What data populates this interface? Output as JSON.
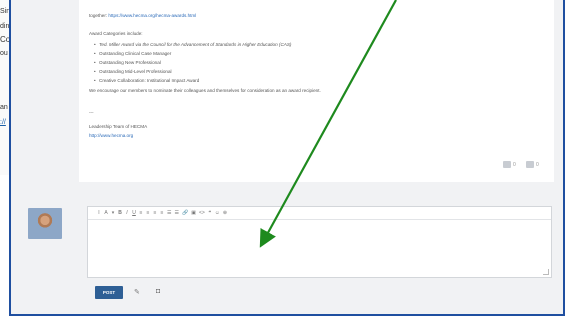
{
  "background_page": {
    "fragments": [
      "Sin",
      "din",
      "Co",
      "ou",
      "an",
      "://"
    ]
  },
  "post": {
    "together_text": "together:",
    "together_link": "https://www.hecma.org/hecma-awards.html",
    "categories_intro": "Award Categories include:",
    "categories": [
      "Ted. Miller Award via the Council for the Advancement of Standards in Higher Education (CAS)",
      "Outstanding Clinical Case Manager",
      "Outstanding New Professional",
      "Outstanding Mid-Level Professional",
      "Creative Collaboration: Institutional Impact Award"
    ],
    "encourage_text": "We encourage our members to nominate their colleagues and themselves for consideration as an award recipient.",
    "signature_dash": "---",
    "signature_team": "Leadership Team of HECMA",
    "signature_link": "http://www.hecma.org",
    "reactions": {
      "like_count": "0",
      "dislike_count": "0"
    }
  },
  "reply": {
    "toolbar": [
      "I",
      "A",
      "▾",
      "B",
      "I",
      "U",
      "≡",
      "≡",
      "≡",
      "≡",
      "☰",
      "☰",
      "🔗",
      "▣",
      "<>",
      "❝",
      "☺",
      "⊕"
    ],
    "post_button_label": "POST"
  },
  "colors": {
    "frame_border": "#1f4fa0",
    "arrow": "#1e8a1e",
    "post_button": "#2e5f95"
  }
}
